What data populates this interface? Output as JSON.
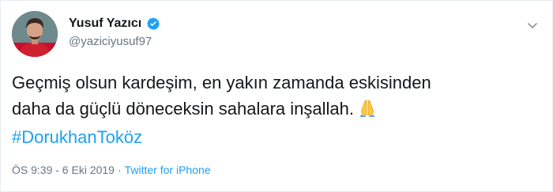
{
  "tweet": {
    "author": {
      "display_name": "Yusuf Yazıcı",
      "handle": "@yaziciyusuf97",
      "verified": true
    },
    "text_lines": [
      "Geçmiş olsun kardeşim, en yakın zamanda eskisinden",
      "daha da güçlü döneceksin sahalara inşallah."
    ],
    "emoji": "folded-hands",
    "hashtag": "#DorukhanToköz",
    "timestamp": "ÖS 9:39 - 6 Eki 2019",
    "separator": "·",
    "source": "Twitter for iPhone"
  },
  "colors": {
    "link": "#1da1f2",
    "secondary_text": "#657786",
    "primary_text": "#14171a",
    "border": "#e6ecf0"
  },
  "icons": {
    "verified": "verified-badge-icon",
    "menu": "chevron-down-icon",
    "emoji": "folded-hands-emoji"
  }
}
